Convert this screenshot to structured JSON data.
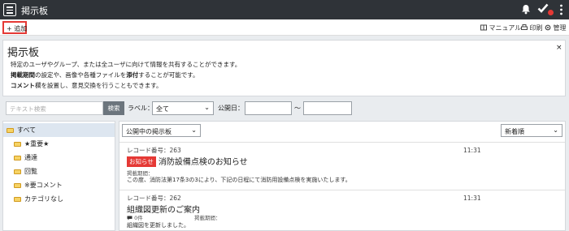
{
  "header": {
    "title": "掲示板",
    "icons": [
      "menu-icon",
      "bell-icon",
      "check-icon",
      "more-vertical-icon"
    ],
    "notification_color": "#e53935"
  },
  "toolbar": {
    "add_label": "+ 追加",
    "manual_label": "マニュアル",
    "print_label": "印刷",
    "admin_label": "管理"
  },
  "intro": {
    "title": "掲示板",
    "close": "×",
    "line1": "特定のユーザやグループ、または全ユーザに向けて情報を共有することができます。",
    "line2_bold": "掲載期間",
    "line2_mid": "の設定や、画像や各種ファイルを",
    "line2_bold2": "添付",
    "line2_end": "することが可能です。",
    "line3_bold": "コメント",
    "line3_end": "欄を設置し、意見交換を行うこともできます。"
  },
  "filters": {
    "search_placeholder": "テキスト検索",
    "search_button": "検索",
    "label_label": "ラベル：",
    "label_value": "全て",
    "date_label": "公開日：",
    "date_sep": "〜"
  },
  "categories": [
    {
      "label": "すべて",
      "active": true
    },
    {
      "label": "★重要★",
      "active": false
    },
    {
      "label": "通達",
      "active": false
    },
    {
      "label": "回覧",
      "active": false
    },
    {
      "label": "※要コメント",
      "active": false
    },
    {
      "label": "カテゴリなし",
      "active": false
    }
  ],
  "main": {
    "status_filter": "公開中の掲示板",
    "sort": "新着順"
  },
  "posts": [
    {
      "record": "レコード番号：263",
      "time": "11:31",
      "badge": "お知らせ",
      "title": "消防設備点検のお知らせ",
      "period_label": "掲載期間：",
      "body": "この度、消防法第17条3の3により、下記の日程にて消防用設備点検を実施いたします。"
    },
    {
      "record": "レコード番号：262",
      "time": "11:31",
      "title": "組織図更新のご案内",
      "comment_count": "0件",
      "period_label": "掲載期間：",
      "body": "組織図を更新しました。"
    }
  ]
}
